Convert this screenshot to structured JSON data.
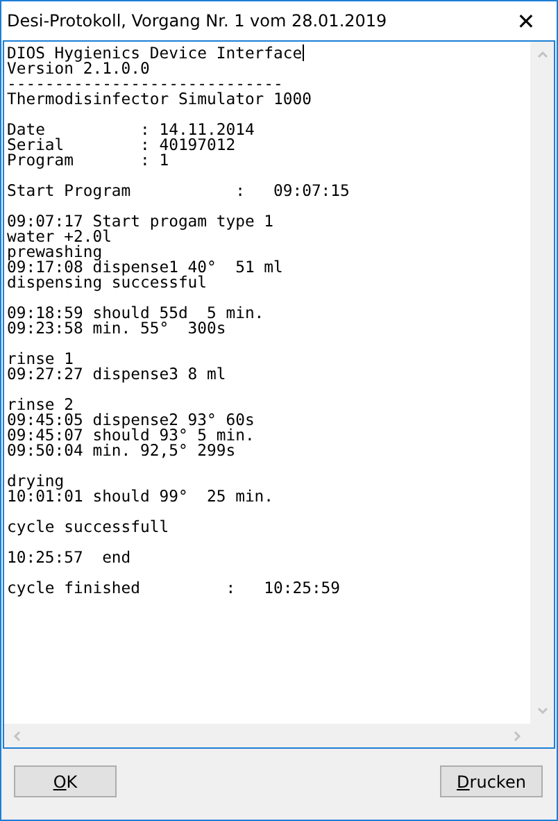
{
  "window": {
    "title": "Desi-Protokoll, Vorgang Nr. 1 vom 28.01.2019",
    "close": "✕"
  },
  "protocol": {
    "blocks": [
      [
        "DIOS Hygienics Device Interface",
        "Version 2.1.0.0",
        "-----------------------------",
        "Thermodisinfector Simulator 1000"
      ],
      [
        "Date          : 14.11.2014",
        "Serial        : 40197012",
        "Program       : 1"
      ],
      [
        "Start Program           :   09:07:15"
      ],
      [
        "09:07:17 Start progam type 1",
        "water +2.0l",
        "prewashing",
        "09:17:08 dispense1 40°  51 ml",
        "dispensing successful"
      ],
      [
        "09:18:59 should 55d  5 min.",
        "09:23:58 min. 55°  300s"
      ],
      [
        "rinse 1",
        "09:27:27 dispense3 8 ml"
      ],
      [
        "rinse 2",
        "09:45:05 dispense2 93° 60s",
        "09:45:07 should 93° 5 min.",
        "09:50:04 min. 92,5° 299s"
      ],
      [
        "drying",
        "10:01:01 should 99°  25 min."
      ],
      [
        "cycle successfull"
      ],
      [
        "10:25:57  end"
      ],
      [
        "cycle finished         :   10:25:59"
      ]
    ]
  },
  "buttons": [
    {
      "label": "OK"
    },
    {
      "label": "Drucken"
    }
  ]
}
